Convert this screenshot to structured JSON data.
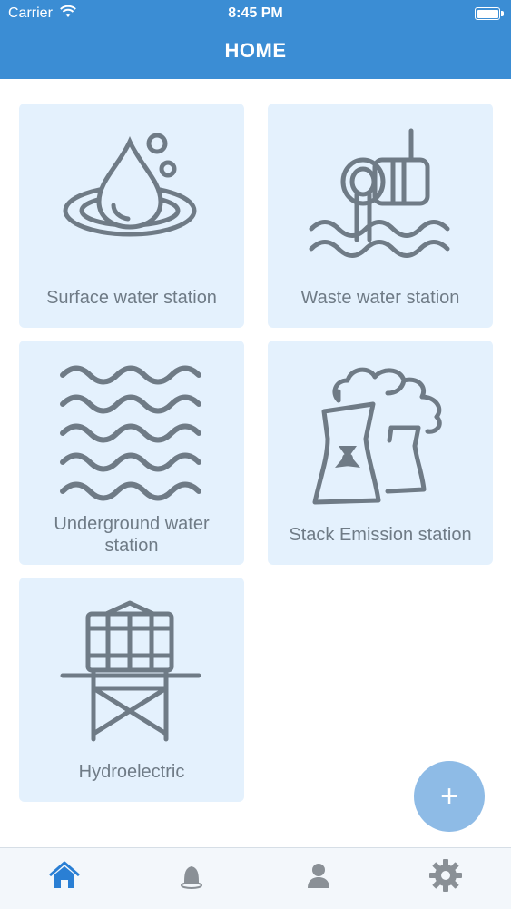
{
  "status_bar": {
    "carrier": "Carrier",
    "time": "8:45 PM"
  },
  "header": {
    "title": "HOME"
  },
  "stations": [
    {
      "label": "Surface water station",
      "icon": "water-drop-icon"
    },
    {
      "label": "Waste water station",
      "icon": "pipe-outflow-icon"
    },
    {
      "label_line1": "Underground water",
      "label_line2": "station",
      "icon": "waves-icon"
    },
    {
      "label": "Stack Emission station",
      "icon": "cooling-tower-icon"
    },
    {
      "label": "Hydroelectric",
      "icon": "water-tower-icon"
    }
  ],
  "fab": {
    "symbol": "+",
    "color": "#8ebbe6"
  },
  "tab_bar": {
    "active_color": "#2a7fd4",
    "inactive_color": "#8a9096",
    "tabs": [
      "home-icon",
      "bell-icon",
      "user-icon",
      "gear-icon"
    ]
  },
  "theme": {
    "header_color": "#3b8dd4",
    "card_color": "#e4f1fd",
    "icon_color": "#6f7b86"
  }
}
